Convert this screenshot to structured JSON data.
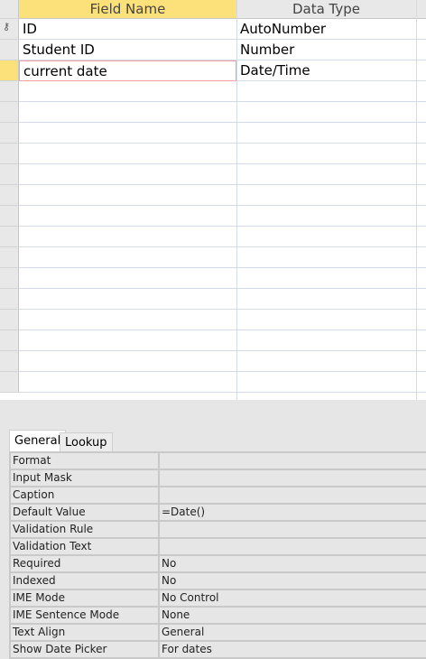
{
  "grid": {
    "headers": {
      "field_name": "Field Name",
      "data_type": "Data Type"
    },
    "rows": [
      {
        "field": "ID",
        "type": "AutoNumber",
        "primary_key": true
      },
      {
        "field": "Student ID",
        "type": "Number"
      },
      {
        "field": "current date",
        "type": "Date/Time",
        "selected": true
      }
    ]
  },
  "tabs": [
    "General",
    "Lookup"
  ],
  "properties": [
    {
      "label": "Format",
      "value": ""
    },
    {
      "label": "Input Mask",
      "value": ""
    },
    {
      "label": "Caption",
      "value": ""
    },
    {
      "label": "Default Value",
      "value": "=Date()"
    },
    {
      "label": "Validation Rule",
      "value": ""
    },
    {
      "label": "Validation Text",
      "value": ""
    },
    {
      "label": "Required",
      "value": "No"
    },
    {
      "label": "Indexed",
      "value": "No"
    },
    {
      "label": "IME Mode",
      "value": "No Control"
    },
    {
      "label": "IME Sentence Mode",
      "value": "None"
    },
    {
      "label": "Text Align",
      "value": "General"
    },
    {
      "label": "Show Date Picker",
      "value": "For dates"
    }
  ]
}
